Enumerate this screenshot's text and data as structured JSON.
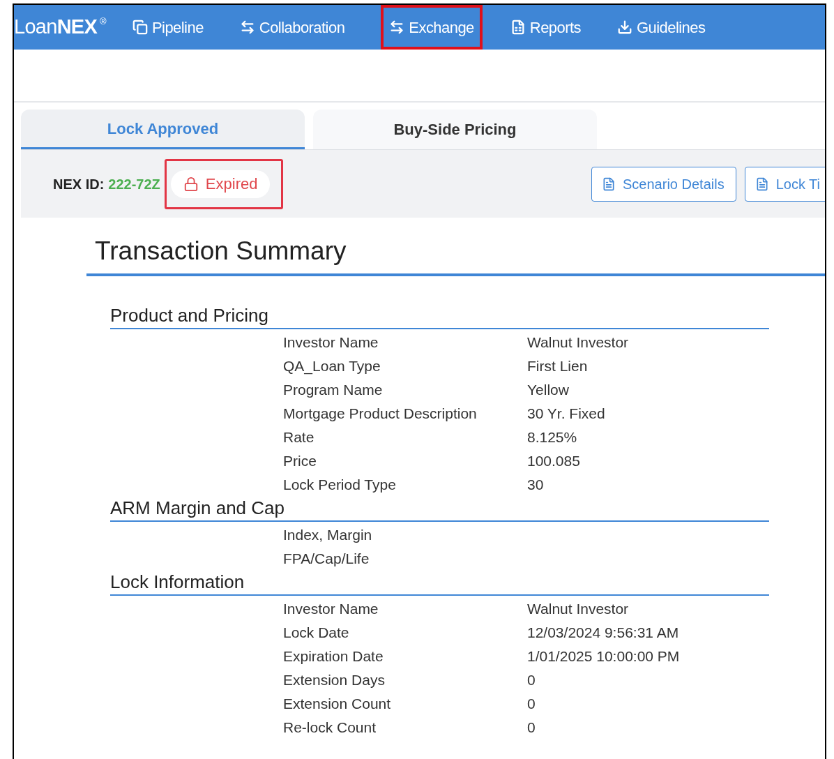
{
  "nav": {
    "logo": {
      "light": "Loan",
      "bold": "NEX",
      "mark": "®"
    },
    "items": [
      {
        "label": "Pipeline",
        "kind": "copy",
        "highlighted": false
      },
      {
        "label": "Collaboration",
        "kind": "swap",
        "highlighted": false
      },
      {
        "label": "Exchange",
        "kind": "swap",
        "highlighted": true
      },
      {
        "label": "Reports",
        "kind": "excel",
        "highlighted": false
      },
      {
        "label": "Guidelines",
        "kind": "download",
        "highlighted": false
      }
    ]
  },
  "tabs": [
    {
      "label": "Lock Approved",
      "selected": true
    },
    {
      "label": "Buy-Side Pricing",
      "selected": false
    }
  ],
  "header": {
    "id_label": "NEX ID:",
    "id_value": "222-72Z",
    "status": {
      "label": "Expired",
      "highlighted": true
    },
    "buttons": [
      "Scenario Details",
      "Lock Ti"
    ]
  },
  "title": "Transaction Summary",
  "sections": [
    {
      "title": "Product and Pricing",
      "rows": [
        {
          "label": "Investor Name",
          "value": "Walnut Investor"
        },
        {
          "label": "QA_Loan Type",
          "value": "First Lien"
        },
        {
          "label": "Program Name",
          "value": "Yellow"
        },
        {
          "label": "Mortgage Product Description",
          "value": "30 Yr. Fixed"
        },
        {
          "label": "Rate",
          "value": "8.125%"
        },
        {
          "label": "Price",
          "value": "100.085"
        },
        {
          "label": "Lock Period Type",
          "value": "30"
        }
      ]
    },
    {
      "title": "ARM Margin and Cap",
      "rows": [
        {
          "label": "Index, Margin"
        },
        {
          "label": "FPA/Cap/Life"
        }
      ]
    },
    {
      "title": "Lock Information",
      "rows": [
        {
          "label": "Investor Name",
          "value": "Walnut Investor"
        },
        {
          "label": "Lock Date",
          "value": "12/03/2024 9:56:31 AM"
        },
        {
          "label": "Expiration Date",
          "value": "1/01/2025 10:00:00 PM"
        },
        {
          "label": "Extension Days",
          "value": "0"
        },
        {
          "label": "Extension Count",
          "value": "0"
        },
        {
          "label": "Re-lock Count",
          "value": "0"
        }
      ]
    }
  ]
}
